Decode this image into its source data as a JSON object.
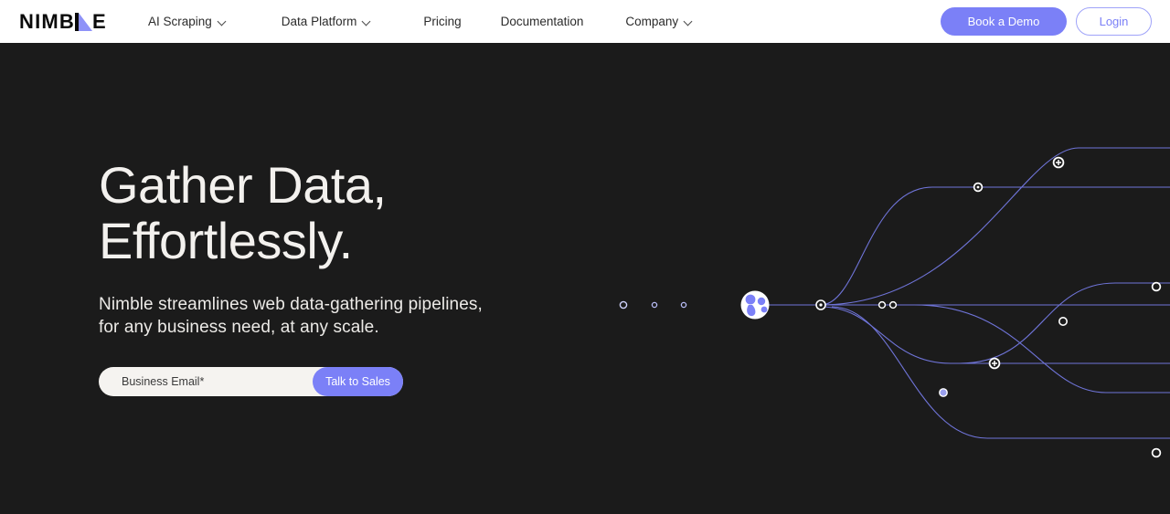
{
  "brand": {
    "name_part1": "NIMB",
    "name_part2": "E",
    "logo_icon": "nimble-triangle-logo",
    "accent_color": "#7b80f7",
    "logo_triangle_color": "#8e92f8"
  },
  "nav": {
    "items": [
      {
        "label": "AI Scraping",
        "has_dropdown": true,
        "icon": "chevron-down-icon"
      },
      {
        "label": "Data Platform",
        "has_dropdown": true,
        "icon": "chevron-down-icon"
      },
      {
        "label": "Pricing",
        "has_dropdown": false,
        "icon": ""
      },
      {
        "label": "Documentation",
        "has_dropdown": false,
        "icon": ""
      },
      {
        "label": "Company",
        "has_dropdown": true,
        "icon": "chevron-down-icon"
      }
    ],
    "demo_button": "Book a Demo",
    "login_button": "Login"
  },
  "hero": {
    "title": "Gather Data,\nEffortlessly.",
    "subtitle": "Nimble streamlines web data-gathering pipelines,\nfor any business need, at any scale.",
    "email_placeholder": "Business Email*",
    "email_value": "",
    "cta_button": "Talk to Sales",
    "background_color": "#1b1b1b",
    "text_color": "#f3f1ee"
  },
  "graphic": {
    "name": "data-pipeline-network-diagram",
    "hub_icon": "nimble-hub-node",
    "line_color": "#6f74d8",
    "node_color": "#ffffff",
    "hub_background": "#ffffff",
    "hub_blob_color": "#7b80f7"
  }
}
